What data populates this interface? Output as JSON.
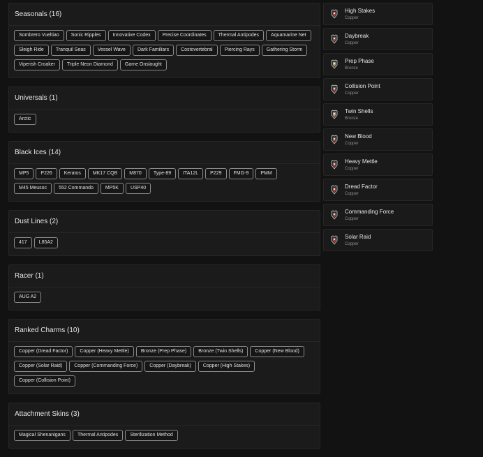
{
  "sections": [
    {
      "title": "Seasonals (16)",
      "chips": [
        "Sombrero Vueltiao",
        "Sonic Ripples",
        "Innovative Codex",
        "Precise Coordinates",
        "Thermal Antipodes",
        "Aquamarine Net",
        "Sleigh Ride",
        "Tranquil Seas",
        "Vessel Wave",
        "Dark Familiars",
        "Costovertebral",
        "Piercing Rays",
        "Gathering Storm",
        "Viperish Croaker",
        "Triple Neon Diamond",
        "Game Onslaught"
      ]
    },
    {
      "title": "Universals (1)",
      "chips": [
        "Arctic"
      ]
    },
    {
      "title": "Black Ices (14)",
      "chips": [
        "MP5",
        "P226",
        "Keratos",
        "MK17 CQB",
        "M870",
        "Type-89",
        "ITA12L",
        "P229",
        "FMG-9",
        "PMM",
        "M45 Meusoc",
        "552 Commando",
        "MP5K",
        "USP40"
      ]
    },
    {
      "title": "Dust Lines (2)",
      "chips": [
        "417",
        "L85A2"
      ]
    },
    {
      "title": "Racer (1)",
      "chips": [
        "AUG A2"
      ]
    },
    {
      "title": "Ranked Charms (10)",
      "chips": [
        "Copper (Dread Factor)",
        "Copper (Heavy Mettle)",
        "Bronze (Prep Phase)",
        "Bronze (Twin Shells)",
        "Copper (New Blood)",
        "Copper (Solar Raid)",
        "Copper (Commanding Force)",
        "Copper (Daybreak)",
        "Copper (High Stakes)",
        "Copper (Collision Point)"
      ]
    },
    {
      "title": "Attachment Skins (3)",
      "chips": [
        "Magical Shenanigans",
        "Thermal Antipodes",
        "Sterilization Method"
      ]
    }
  ],
  "charms": [
    {
      "name": "High Stakes",
      "tier": "Copper"
    },
    {
      "name": "Daybreak",
      "tier": "Copper"
    },
    {
      "name": "Prep Phase",
      "tier": "Bronze"
    },
    {
      "name": "Collision Point",
      "tier": "Copper"
    },
    {
      "name": "Twin Shells",
      "tier": "Bronze"
    },
    {
      "name": "New Blood",
      "tier": "Copper"
    },
    {
      "name": "Heavy Mettle",
      "tier": "Copper"
    },
    {
      "name": "Dread Factor",
      "tier": "Copper"
    },
    {
      "name": "Commanding Force",
      "tier": "Copper"
    },
    {
      "name": "Solar Raid",
      "tier": "Copper"
    }
  ],
  "colors": {
    "copper_badge": "#b8433c",
    "bronze_badge": "#b39a76",
    "background": "#121212"
  }
}
